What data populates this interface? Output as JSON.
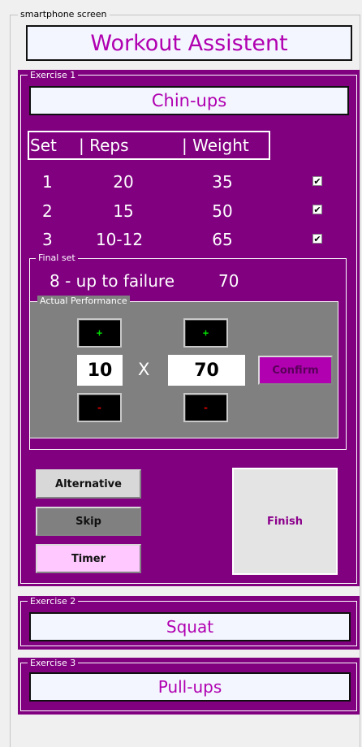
{
  "screen": {
    "label": "smartphone screen",
    "title": "Workout Assistent"
  },
  "exercise1": {
    "legend": "Exercise 1",
    "name": "Chin-ups",
    "header": {
      "set": "Set",
      "reps": "| Reps",
      "weight": "| Weight"
    },
    "rows": [
      {
        "set": "1",
        "reps": "20",
        "weight": "35",
        "done": "✔"
      },
      {
        "set": "2",
        "reps": "15",
        "weight": "50",
        "done": "✔"
      },
      {
        "set": "3",
        "reps": "10-12",
        "weight": "65",
        "done": "✔"
      }
    ],
    "final_set": {
      "legend": "Final set",
      "reps": "8 - up to failure",
      "weight": "70",
      "actual": {
        "legend": "Actual Performance",
        "plus": "+",
        "minus": "-",
        "reps_value": "10",
        "times": "X",
        "weight_value": "70",
        "confirm_label": "Confirm"
      }
    },
    "buttons": {
      "alternative": "Alternative",
      "skip": "Skip",
      "timer": "Timer",
      "finish": "Finish"
    }
  },
  "exercise2": {
    "legend": "Exercise 2",
    "name": "Squat"
  },
  "exercise3": {
    "legend": "Exercise 3",
    "name": "Pull-ups"
  },
  "colors": {
    "panel": "#800080",
    "title_text": "#b000b0",
    "confirm": "#b000b0",
    "timer": "#ffc8ff"
  }
}
